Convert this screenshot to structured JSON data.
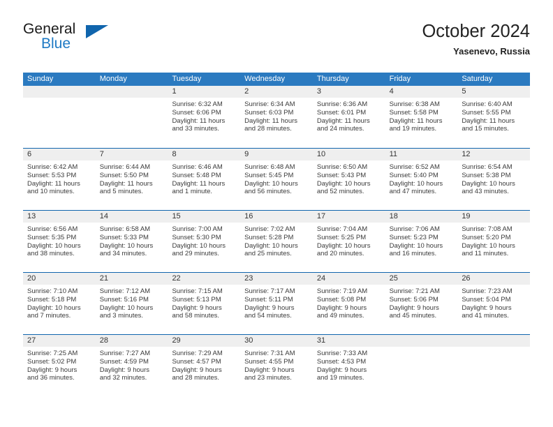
{
  "brand": {
    "name_primary": "General",
    "name_secondary": "Blue",
    "triangle_color": "#1065ad",
    "accent_color": "#1f7ac4"
  },
  "header": {
    "title": "October 2024",
    "subtitle": "Yasenevo, Russia"
  },
  "colors": {
    "header_bar": "#2b7ac0",
    "row_divider": "#1065ad",
    "day_band": "#efefef",
    "text": "#3a3a3a"
  },
  "weekdays": [
    "Sunday",
    "Monday",
    "Tuesday",
    "Wednesday",
    "Thursday",
    "Friday",
    "Saturday"
  ],
  "weeks": [
    [
      {
        "day": "",
        "empty": true,
        "sunrise": "",
        "sunset": "",
        "daylight_line1": "",
        "daylight_line2": ""
      },
      {
        "day": "",
        "empty": true,
        "sunrise": "",
        "sunset": "",
        "daylight_line1": "",
        "daylight_line2": ""
      },
      {
        "day": "1",
        "empty": false,
        "sunrise": "Sunrise: 6:32 AM",
        "sunset": "Sunset: 6:06 PM",
        "daylight_line1": "Daylight: 11 hours",
        "daylight_line2": "and 33 minutes."
      },
      {
        "day": "2",
        "empty": false,
        "sunrise": "Sunrise: 6:34 AM",
        "sunset": "Sunset: 6:03 PM",
        "daylight_line1": "Daylight: 11 hours",
        "daylight_line2": "and 28 minutes."
      },
      {
        "day": "3",
        "empty": false,
        "sunrise": "Sunrise: 6:36 AM",
        "sunset": "Sunset: 6:01 PM",
        "daylight_line1": "Daylight: 11 hours",
        "daylight_line2": "and 24 minutes."
      },
      {
        "day": "4",
        "empty": false,
        "sunrise": "Sunrise: 6:38 AM",
        "sunset": "Sunset: 5:58 PM",
        "daylight_line1": "Daylight: 11 hours",
        "daylight_line2": "and 19 minutes."
      },
      {
        "day": "5",
        "empty": false,
        "sunrise": "Sunrise: 6:40 AM",
        "sunset": "Sunset: 5:55 PM",
        "daylight_line1": "Daylight: 11 hours",
        "daylight_line2": "and 15 minutes."
      }
    ],
    [
      {
        "day": "6",
        "empty": false,
        "sunrise": "Sunrise: 6:42 AM",
        "sunset": "Sunset: 5:53 PM",
        "daylight_line1": "Daylight: 11 hours",
        "daylight_line2": "and 10 minutes."
      },
      {
        "day": "7",
        "empty": false,
        "sunrise": "Sunrise: 6:44 AM",
        "sunset": "Sunset: 5:50 PM",
        "daylight_line1": "Daylight: 11 hours",
        "daylight_line2": "and 5 minutes."
      },
      {
        "day": "8",
        "empty": false,
        "sunrise": "Sunrise: 6:46 AM",
        "sunset": "Sunset: 5:48 PM",
        "daylight_line1": "Daylight: 11 hours",
        "daylight_line2": "and 1 minute."
      },
      {
        "day": "9",
        "empty": false,
        "sunrise": "Sunrise: 6:48 AM",
        "sunset": "Sunset: 5:45 PM",
        "daylight_line1": "Daylight: 10 hours",
        "daylight_line2": "and 56 minutes."
      },
      {
        "day": "10",
        "empty": false,
        "sunrise": "Sunrise: 6:50 AM",
        "sunset": "Sunset: 5:43 PM",
        "daylight_line1": "Daylight: 10 hours",
        "daylight_line2": "and 52 minutes."
      },
      {
        "day": "11",
        "empty": false,
        "sunrise": "Sunrise: 6:52 AM",
        "sunset": "Sunset: 5:40 PM",
        "daylight_line1": "Daylight: 10 hours",
        "daylight_line2": "and 47 minutes."
      },
      {
        "day": "12",
        "empty": false,
        "sunrise": "Sunrise: 6:54 AM",
        "sunset": "Sunset: 5:38 PM",
        "daylight_line1": "Daylight: 10 hours",
        "daylight_line2": "and 43 minutes."
      }
    ],
    [
      {
        "day": "13",
        "empty": false,
        "sunrise": "Sunrise: 6:56 AM",
        "sunset": "Sunset: 5:35 PM",
        "daylight_line1": "Daylight: 10 hours",
        "daylight_line2": "and 38 minutes."
      },
      {
        "day": "14",
        "empty": false,
        "sunrise": "Sunrise: 6:58 AM",
        "sunset": "Sunset: 5:33 PM",
        "daylight_line1": "Daylight: 10 hours",
        "daylight_line2": "and 34 minutes."
      },
      {
        "day": "15",
        "empty": false,
        "sunrise": "Sunrise: 7:00 AM",
        "sunset": "Sunset: 5:30 PM",
        "daylight_line1": "Daylight: 10 hours",
        "daylight_line2": "and 29 minutes."
      },
      {
        "day": "16",
        "empty": false,
        "sunrise": "Sunrise: 7:02 AM",
        "sunset": "Sunset: 5:28 PM",
        "daylight_line1": "Daylight: 10 hours",
        "daylight_line2": "and 25 minutes."
      },
      {
        "day": "17",
        "empty": false,
        "sunrise": "Sunrise: 7:04 AM",
        "sunset": "Sunset: 5:25 PM",
        "daylight_line1": "Daylight: 10 hours",
        "daylight_line2": "and 20 minutes."
      },
      {
        "day": "18",
        "empty": false,
        "sunrise": "Sunrise: 7:06 AM",
        "sunset": "Sunset: 5:23 PM",
        "daylight_line1": "Daylight: 10 hours",
        "daylight_line2": "and 16 minutes."
      },
      {
        "day": "19",
        "empty": false,
        "sunrise": "Sunrise: 7:08 AM",
        "sunset": "Sunset: 5:20 PM",
        "daylight_line1": "Daylight: 10 hours",
        "daylight_line2": "and 11 minutes."
      }
    ],
    [
      {
        "day": "20",
        "empty": false,
        "sunrise": "Sunrise: 7:10 AM",
        "sunset": "Sunset: 5:18 PM",
        "daylight_line1": "Daylight: 10 hours",
        "daylight_line2": "and 7 minutes."
      },
      {
        "day": "21",
        "empty": false,
        "sunrise": "Sunrise: 7:12 AM",
        "sunset": "Sunset: 5:16 PM",
        "daylight_line1": "Daylight: 10 hours",
        "daylight_line2": "and 3 minutes."
      },
      {
        "day": "22",
        "empty": false,
        "sunrise": "Sunrise: 7:15 AM",
        "sunset": "Sunset: 5:13 PM",
        "daylight_line1": "Daylight: 9 hours",
        "daylight_line2": "and 58 minutes."
      },
      {
        "day": "23",
        "empty": false,
        "sunrise": "Sunrise: 7:17 AM",
        "sunset": "Sunset: 5:11 PM",
        "daylight_line1": "Daylight: 9 hours",
        "daylight_line2": "and 54 minutes."
      },
      {
        "day": "24",
        "empty": false,
        "sunrise": "Sunrise: 7:19 AM",
        "sunset": "Sunset: 5:08 PM",
        "daylight_line1": "Daylight: 9 hours",
        "daylight_line2": "and 49 minutes."
      },
      {
        "day": "25",
        "empty": false,
        "sunrise": "Sunrise: 7:21 AM",
        "sunset": "Sunset: 5:06 PM",
        "daylight_line1": "Daylight: 9 hours",
        "daylight_line2": "and 45 minutes."
      },
      {
        "day": "26",
        "empty": false,
        "sunrise": "Sunrise: 7:23 AM",
        "sunset": "Sunset: 5:04 PM",
        "daylight_line1": "Daylight: 9 hours",
        "daylight_line2": "and 41 minutes."
      }
    ],
    [
      {
        "day": "27",
        "empty": false,
        "sunrise": "Sunrise: 7:25 AM",
        "sunset": "Sunset: 5:02 PM",
        "daylight_line1": "Daylight: 9 hours",
        "daylight_line2": "and 36 minutes."
      },
      {
        "day": "28",
        "empty": false,
        "sunrise": "Sunrise: 7:27 AM",
        "sunset": "Sunset: 4:59 PM",
        "daylight_line1": "Daylight: 9 hours",
        "daylight_line2": "and 32 minutes."
      },
      {
        "day": "29",
        "empty": false,
        "sunrise": "Sunrise: 7:29 AM",
        "sunset": "Sunset: 4:57 PM",
        "daylight_line1": "Daylight: 9 hours",
        "daylight_line2": "and 28 minutes."
      },
      {
        "day": "30",
        "empty": false,
        "sunrise": "Sunrise: 7:31 AM",
        "sunset": "Sunset: 4:55 PM",
        "daylight_line1": "Daylight: 9 hours",
        "daylight_line2": "and 23 minutes."
      },
      {
        "day": "31",
        "empty": false,
        "sunrise": "Sunrise: 7:33 AM",
        "sunset": "Sunset: 4:53 PM",
        "daylight_line1": "Daylight: 9 hours",
        "daylight_line2": "and 19 minutes."
      },
      {
        "day": "",
        "empty": true,
        "sunrise": "",
        "sunset": "",
        "daylight_line1": "",
        "daylight_line2": ""
      },
      {
        "day": "",
        "empty": true,
        "sunrise": "",
        "sunset": "",
        "daylight_line1": "",
        "daylight_line2": ""
      }
    ]
  ]
}
